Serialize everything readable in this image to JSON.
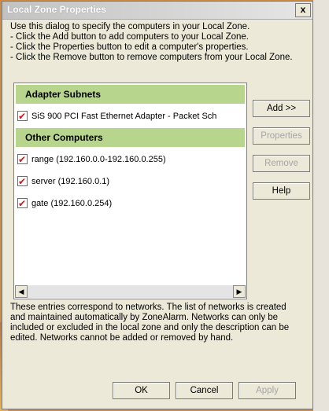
{
  "window": {
    "title": "Local Zone Properties",
    "close_glyph": "x"
  },
  "intro_lines": [
    "Use this dialog to specify the computers in your Local Zone.",
    "- Click the Add button to add computers to your Local Zone.",
    "- Click the Properties button to edit a computer's properties.",
    "- Click the Remove button to remove computers from your Local Zone."
  ],
  "list": {
    "groups": [
      {
        "header": "Adapter Subnets",
        "items": [
          {
            "label": "SiS 900 PCI Fast Ethernet Adapter - Packet Sch",
            "checked": true
          }
        ]
      },
      {
        "header": "Other Computers",
        "items": [
          {
            "label": "range (192.160.0.0-192.160.0.255)",
            "checked": true
          },
          {
            "label": "server (192.160.0.1)",
            "checked": true
          },
          {
            "label": "gate (192.160.0.254)",
            "checked": true
          }
        ]
      }
    ],
    "scroll_left_glyph": "◀",
    "scroll_right_glyph": "▶"
  },
  "side_buttons": {
    "add": "Add >>",
    "properties": "Properties",
    "remove": "Remove",
    "help": "Help"
  },
  "note_lines": [
    "These entries correspond to networks.  The list of networks is created",
    "and maintained automatically by ZoneAlarm. Networks can only be",
    "included or excluded in the local zone and only the description can be",
    "edited. Networks cannot be added or removed by hand."
  ],
  "footer_buttons": {
    "ok": "OK",
    "cancel": "Cancel",
    "apply": "Apply"
  },
  "colors": {
    "group_header": "#b8d58e",
    "check_mark": "#dd1111",
    "dialog_bg": "#ece9d8"
  }
}
